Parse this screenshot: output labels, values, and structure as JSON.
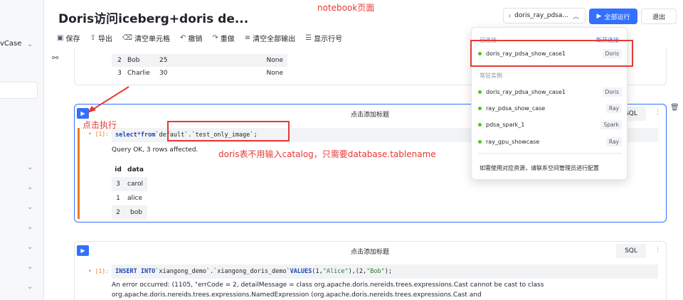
{
  "left_panel": {
    "case_label": "vCase"
  },
  "header": {
    "title": "Doris访问iceberg+doris de...",
    "engine_select": "doris_ray_pdsa...",
    "run_all_label": "全部运行",
    "exit_label": "退出"
  },
  "annotations": {
    "notebook_page": "notebook页面",
    "click_execute": "点击执行",
    "catalog_note": "doris表不用输入catalog，只需要database.tablename"
  },
  "toolbar": {
    "save": "保存",
    "export": "导出",
    "clear_cells": "清空单元格",
    "undo": "撤销",
    "redo": "重做",
    "clear_outputs": "清空全部输出",
    "show_line_numbers": "显示行号"
  },
  "cell0_rows": [
    {
      "idx": "2",
      "name": "Bob",
      "age": "25",
      "val": "None"
    },
    {
      "idx": "3",
      "name": "Charlie",
      "age": "30",
      "val": "None"
    }
  ],
  "cell1": {
    "title": "点击添加标题",
    "lang": "SQL",
    "prompt": "• [1]:",
    "code_kw1": "select",
    "code_star": " * ",
    "code_kw2": "from",
    "code_rest": " `default`.`test_only_image`;",
    "status": "Query OK, 3 rows affected.",
    "table_headers": [
      "id",
      "data"
    ],
    "table_rows": [
      {
        "id": "3",
        "data": "carol"
      },
      {
        "id": "1",
        "data": "alice"
      },
      {
        "id": "2",
        "data": "bob"
      }
    ]
  },
  "cell2": {
    "title": "点击添加标题",
    "lang": "SQL",
    "prompt": "• [1]:",
    "code_kw1": "INSERT INTO",
    "code_mid": " `xiangong_demo`.`xiangong_doris_demo` ",
    "code_kw2": "VALUES",
    "code_vals": " (1, ",
    "code_s1": "\"Alice\"",
    "code_mid2": "),(2, ",
    "code_s2": "\"Bob\"",
    "code_end": ");",
    "error_line1": "An error occurred: (1105, \"errCode = 2, detailMessage = class org.apache.doris.nereids.trees.expressions.Cast cannot be cast to class",
    "error_line2": "org.apache.doris.nereids.trees.expressions.NamedExpression (org.apache.doris.nereids.trees.expressions.Cast and"
  },
  "popover": {
    "connected_label": "已连接",
    "disconnect": "断开连接",
    "connected_item": {
      "name": "doris_ray_pdsa_show_case1",
      "tag": "Doris"
    },
    "resident_label": "常驻实例",
    "resident_items": [
      {
        "name": "doris_ray_pdsa_show_case1",
        "tag": "Doris"
      },
      {
        "name": "ray_pdsa_show_case",
        "tag": "Ray"
      },
      {
        "name": "pdsa_spark_1",
        "tag": "Spark"
      },
      {
        "name": "ray_gpu_showcase",
        "tag": "Ray"
      }
    ],
    "footer": "如需使用对应资源，请联系空间管理员进行配置"
  },
  "colors": {
    "accent": "#3370ff",
    "annotation_red": "#e53935",
    "status_green": "#52c41a",
    "cell_bar": "#e8792a"
  }
}
